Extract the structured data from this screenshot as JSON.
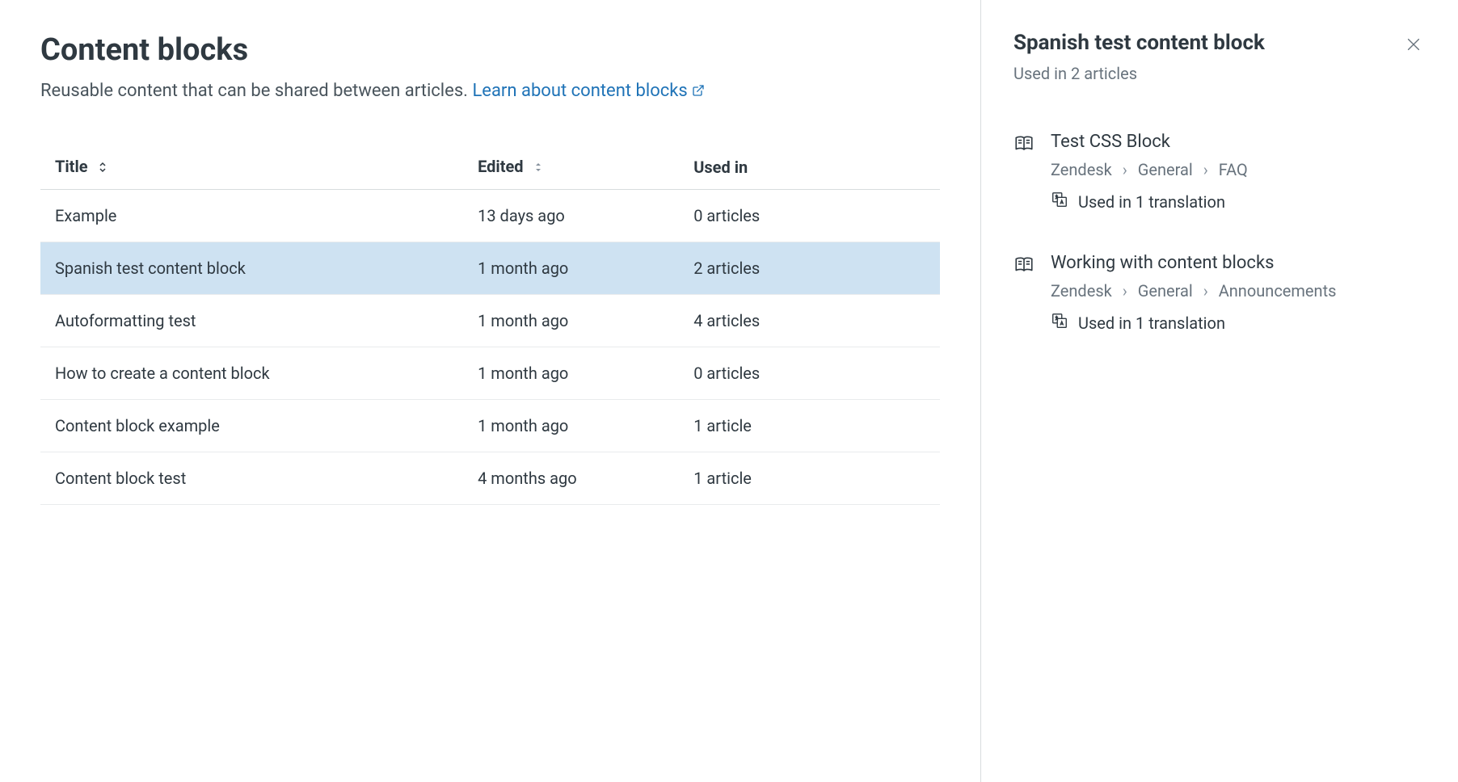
{
  "header": {
    "title": "Content blocks",
    "subtitle_text": "Reusable content that can be shared between articles. ",
    "link_text": "Learn about content blocks"
  },
  "table": {
    "columns": {
      "title": "Title",
      "edited": "Edited",
      "used_in": "Used in"
    },
    "rows": [
      {
        "title": "Example",
        "edited": "13 days ago",
        "used_in": "0 articles",
        "selected": false
      },
      {
        "title": "Spanish test content block",
        "edited": "1 month ago",
        "used_in": "2 articles",
        "selected": true
      },
      {
        "title": "Autoformatting test",
        "edited": "1 month ago",
        "used_in": "4 articles",
        "selected": false
      },
      {
        "title": "How to create a content block",
        "edited": "1 month ago",
        "used_in": "0 articles",
        "selected": false
      },
      {
        "title": "Content block example",
        "edited": "1 month ago",
        "used_in": "1 article",
        "selected": false
      },
      {
        "title": "Content block test",
        "edited": "4 months ago",
        "used_in": "1 article",
        "selected": false
      }
    ]
  },
  "panel": {
    "title": "Spanish test content block",
    "subtitle": "Used in 2 articles",
    "articles": [
      {
        "title": "Test CSS Block",
        "breadcrumb": [
          "Zendesk",
          "General",
          "FAQ"
        ],
        "translation": "Used in 1 translation"
      },
      {
        "title": "Working with content blocks",
        "breadcrumb": [
          "Zendesk",
          "General",
          "Announcements"
        ],
        "translation": "Used in 1 translation"
      }
    ]
  }
}
